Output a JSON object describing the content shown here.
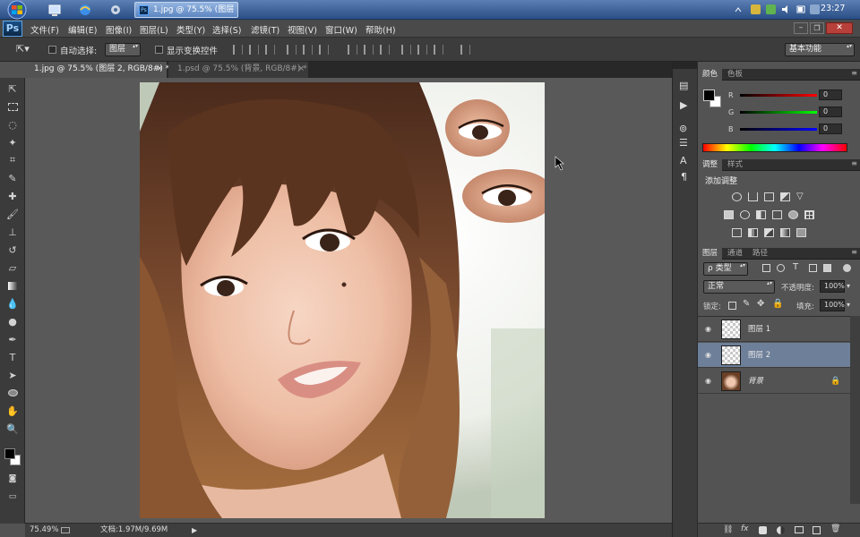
{
  "taskbar": {
    "task_label": "1.jpg @ 75.5% (图层",
    "clock": "23:27",
    "start_icon": "windows-orb-icon",
    "tray_icons": [
      "arrow-up-icon",
      "network-icon",
      "speaker-icon",
      "battery-icon",
      "flag-icon"
    ]
  },
  "app": {
    "logo": "Ps",
    "menu": [
      "文件(F)",
      "编辑(E)",
      "图像(I)",
      "图层(L)",
      "类型(Y)",
      "选择(S)",
      "滤镜(T)",
      "视图(V)",
      "窗口(W)",
      "帮助(H)"
    ],
    "workspace": "基本功能"
  },
  "options": {
    "auto_select_label": "自动选择:",
    "auto_select_value": "图层",
    "show_transform_label": "显示变换控件"
  },
  "tabs": [
    {
      "label": "1.jpg @ 75.5% (图层 2, RGB/8#) *"
    },
    {
      "label": "1.psd @ 75.5% (背景, RGB/8#) *"
    }
  ],
  "status": {
    "zoom": "75.49%",
    "doc_info": "文档:1.97M/9.69M"
  },
  "color_panel": {
    "tabs": [
      "颜色",
      "色板"
    ],
    "channels": [
      {
        "label": "R",
        "value": "0"
      },
      {
        "label": "G",
        "value": "0"
      },
      {
        "label": "B",
        "value": "0"
      }
    ],
    "foreground": "#000000",
    "background": "#ffffff"
  },
  "adjust_panel": {
    "tabs": [
      "调整",
      "样式"
    ],
    "title": "添加调整"
  },
  "layers_panel": {
    "tabs": [
      "图层",
      "通道",
      "路径"
    ],
    "filter_label": "ρ 类型",
    "blend_mode": "正常",
    "opacity_label": "不透明度:",
    "opacity_value": "100%",
    "lock_label": "锁定:",
    "fill_label": "填充:",
    "fill_value": "100%",
    "layers": [
      {
        "name": "图层 1",
        "selected": false
      },
      {
        "name": "图层 2",
        "selected": true
      },
      {
        "name": "背景",
        "selected": false,
        "locked": true
      }
    ]
  },
  "colors": {
    "accent_selected": "#6d7f99",
    "panel": "#535353",
    "toolbar": "#3b3b3b"
  }
}
